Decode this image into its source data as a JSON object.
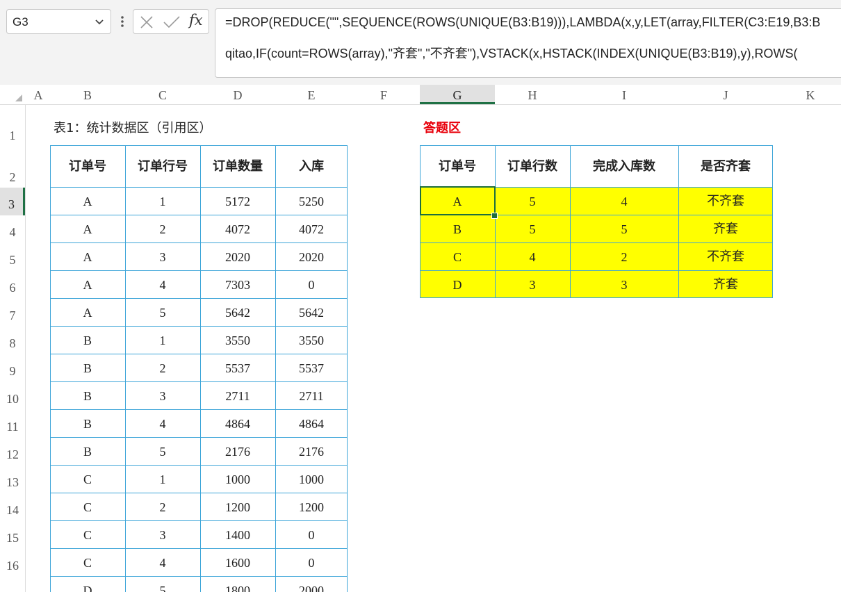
{
  "name_box": {
    "value": "G3",
    "dropdown_icon": "chevron-down-icon"
  },
  "formula_bar": {
    "cancel_icon": "close-icon",
    "confirm_icon": "check-icon",
    "fx_label": "fx",
    "formula_line1": "=DROP(REDUCE(\"\",SEQUENCE(ROWS(UNIQUE(B3:B19))),LAMBDA(x,y,LET(array,FILTER(C3:E19,B3:B",
    "formula_line2": "qitao,IF(count=ROWS(array),\"齐套\",\"不齐套\"),VSTACK(x,HSTACK(INDEX(UNIQUE(B3:B19),y),ROWS("
  },
  "columns": [
    "A",
    "B",
    "C",
    "D",
    "E",
    "F",
    "G",
    "H",
    "I",
    "J",
    "K"
  ],
  "rows": [
    "1",
    "2",
    "3",
    "4",
    "5",
    "6",
    "7",
    "8",
    "9",
    "10",
    "11",
    "12",
    "13",
    "14",
    "15",
    "16"
  ],
  "selected_cell": "G3",
  "table1": {
    "caption": "表1：统计数据区（引用区）",
    "headers": [
      "订单号",
      "订单行号",
      "订单数量",
      "入库"
    ],
    "rows": [
      [
        "A",
        "1",
        "5172",
        "5250"
      ],
      [
        "A",
        "2",
        "4072",
        "4072"
      ],
      [
        "A",
        "3",
        "2020",
        "2020"
      ],
      [
        "A",
        "4",
        "7303",
        "0"
      ],
      [
        "A",
        "5",
        "5642",
        "5642"
      ],
      [
        "B",
        "1",
        "3550",
        "3550"
      ],
      [
        "B",
        "2",
        "5537",
        "5537"
      ],
      [
        "B",
        "3",
        "2711",
        "2711"
      ],
      [
        "B",
        "4",
        "4864",
        "4864"
      ],
      [
        "B",
        "5",
        "2176",
        "2176"
      ],
      [
        "C",
        "1",
        "1000",
        "1000"
      ],
      [
        "C",
        "2",
        "1200",
        "1200"
      ],
      [
        "C",
        "3",
        "1400",
        "0"
      ],
      [
        "C",
        "4",
        "1600",
        "0"
      ],
      [
        "D",
        "5",
        "1800",
        "2000"
      ]
    ]
  },
  "answer": {
    "caption": "答题区",
    "caption_color": "#e8000b",
    "highlight_color": "#ffff00",
    "headers": [
      "订单号",
      "订单行数",
      "完成入库数",
      "是否齐套"
    ],
    "rows": [
      [
        "A",
        "5",
        "4",
        "不齐套"
      ],
      [
        "B",
        "5",
        "5",
        "齐套"
      ],
      [
        "C",
        "4",
        "2",
        "不齐套"
      ],
      [
        "D",
        "3",
        "3",
        "齐套"
      ]
    ]
  }
}
